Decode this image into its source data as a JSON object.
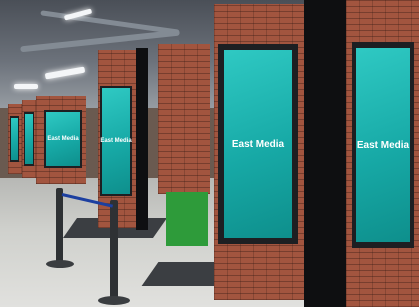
{
  "scene": {
    "description_name": "underground-corridor-with-digital-billboards",
    "accent_color": "#1fb3ae",
    "brick_color": "#a2553f"
  },
  "screens": [
    {
      "id": "far-left-1",
      "text": ""
    },
    {
      "id": "far-left-2",
      "text": ""
    },
    {
      "id": "left-mid",
      "text": "East Media"
    },
    {
      "id": "center-left",
      "text": "East Media"
    },
    {
      "id": "front-center",
      "text": "East Media"
    },
    {
      "id": "front-right",
      "text": "East Media"
    }
  ]
}
